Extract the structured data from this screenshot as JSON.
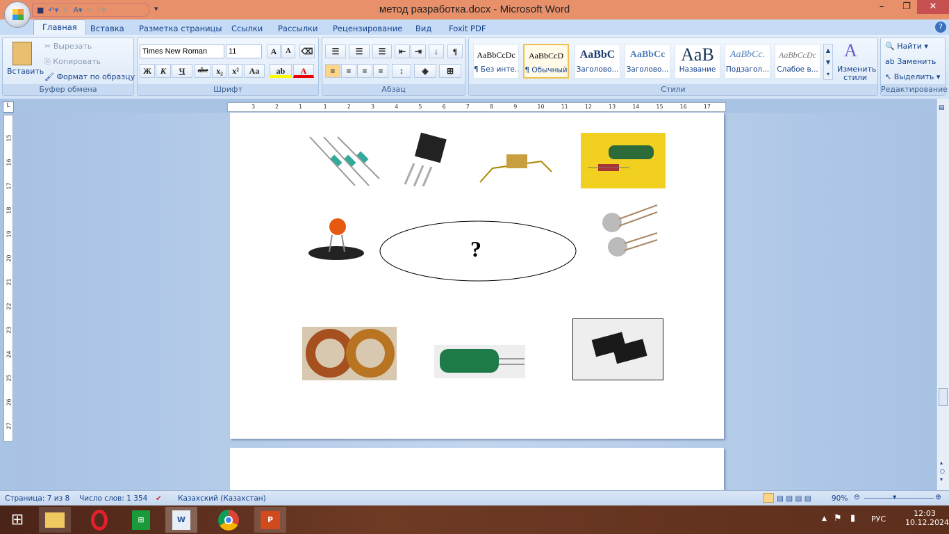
{
  "window": {
    "title": "метод разработка.docx - Microsoft Word",
    "minimize": "–",
    "restore": "❐",
    "close": "✕"
  },
  "tabs": [
    "Главная",
    "Вставка",
    "Разметка страницы",
    "Ссылки",
    "Рассылки",
    "Рецензирование",
    "Вид",
    "Foxit PDF"
  ],
  "clipboard": {
    "label": "Буфер обмена",
    "paste": "Вставить",
    "cut": "Вырезать",
    "copy": "Копировать",
    "format_painter": "Формат по образцу"
  },
  "font": {
    "label": "Шрифт",
    "name": "Times New Roman",
    "size": "11",
    "bold": "Ж",
    "italic": "К",
    "underline": "Ч",
    "strike": "abe",
    "sub": "x₂",
    "sup": "x²",
    "case": "Aa",
    "grow": "A",
    "shrink": "A",
    "color_letter": "A"
  },
  "paragraph": {
    "label": "Абзац",
    "pilcrow": "¶"
  },
  "styles": {
    "label": "Стили",
    "change": "Изменить стили",
    "items": [
      {
        "sample": "AaBbCcDc",
        "name": "¶ Без инте..."
      },
      {
        "sample": "AaBbCcD",
        "name": "¶ Обычный"
      },
      {
        "sample": "AaBbC",
        "name": "Заголово..."
      },
      {
        "sample": "AaBbCc",
        "name": "Заголово..."
      },
      {
        "sample": "AaB",
        "name": "Название"
      },
      {
        "sample": "AaBbCc.",
        "name": "Подзагол..."
      },
      {
        "sample": "AaBbCcDc",
        "name": "Слабое в..."
      }
    ]
  },
  "editing": {
    "label": "Редактирование",
    "find": "Найти",
    "replace": "Заменить",
    "select": "Выделить"
  },
  "ruler": {
    "h": [
      "3",
      "2",
      "1",
      "1",
      "2",
      "3",
      "4",
      "5",
      "6",
      "7",
      "8",
      "9",
      "10",
      "11",
      "12",
      "13",
      "14",
      "15",
      "16",
      "17"
    ],
    "v": [
      "15",
      "16",
      "17",
      "18",
      "19",
      "20",
      "21",
      "22",
      "23",
      "24",
      "25",
      "26",
      "27"
    ]
  },
  "document": {
    "ellipse_text": "?"
  },
  "status": {
    "page": "Страница: 7 из 8",
    "words": "Число слов: 1 354",
    "language": "Казахский (Казахстан)",
    "zoom": "90%"
  },
  "taskbar": {
    "lang": "РУС",
    "time": "12:03",
    "date": "10.12.2024"
  }
}
